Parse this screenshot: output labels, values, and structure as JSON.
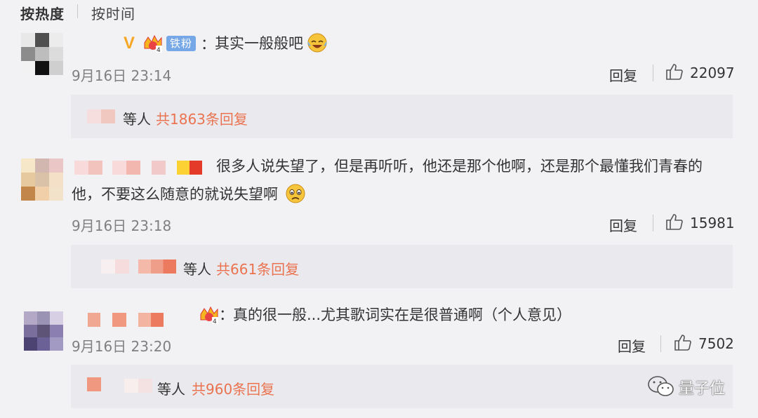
{
  "sort": {
    "hot": "按热度",
    "time": "按时间"
  },
  "comments": [
    {
      "text": "其实一般般吧",
      "badge": "铁粉",
      "time": "9月16日 23:14",
      "reply": "回复",
      "likes": "22097",
      "replies_others": "等人",
      "replies_total": "共1863条回复"
    },
    {
      "line1": "很多人说失望了，但是再听听，他还是那个他啊，还是那个最懂我们青春的",
      "line2": "他，不要这么随意的就说失望啊",
      "time": "9月16日 23:18",
      "reply": "回复",
      "likes": "15981",
      "replies_others": "等人",
      "replies_total": "共661条回复"
    },
    {
      "text": "真的很一般...尤其歌词实在是很普通啊（个人意见）",
      "time": "9月16日 23:20",
      "reply": "回复",
      "likes": "7502",
      "replies_others": "等人",
      "replies_total": "共960条回复"
    }
  ],
  "watermark": "量子位",
  "colors": {
    "accent": "#eb7350",
    "badge": "#76a7e6",
    "background": "#f2f2f5"
  }
}
